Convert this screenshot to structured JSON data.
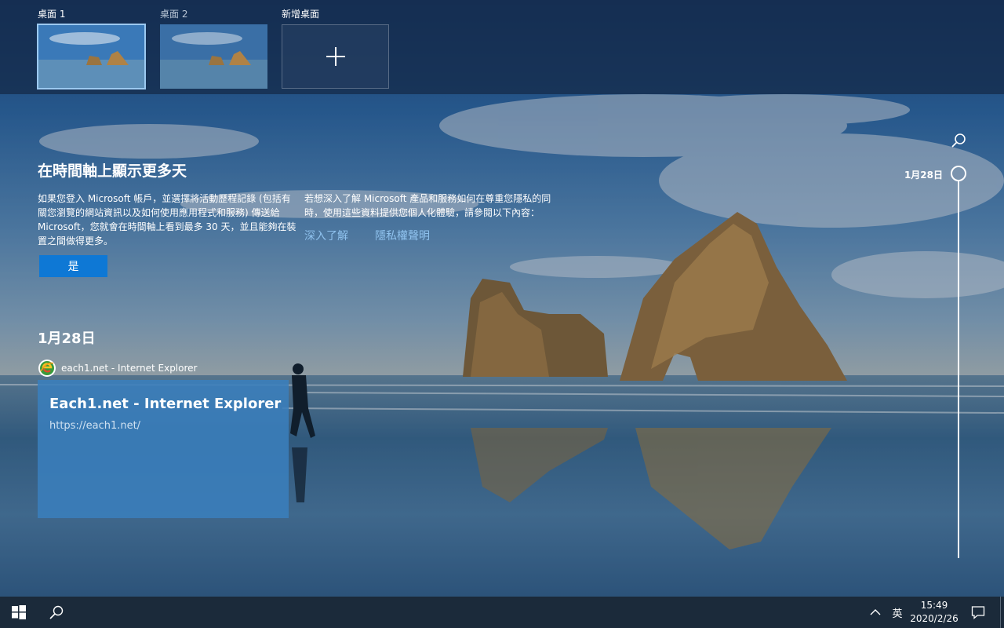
{
  "desktops": [
    {
      "label": "桌面 1",
      "active": true
    },
    {
      "label": "桌面 2",
      "active": false
    }
  ],
  "new_desktop_label": "新增桌面",
  "timeline": {
    "heading": "在時間軸上顯示更多天",
    "left_paragraph": "如果您登入 Microsoft 帳戶，並選擇將活動歷程記錄 (包括有關您瀏覽的網站資訊以及如何使用應用程式和服務) 傳送給 Microsoft，您就會在時間軸上看到最多 30 天，並且能夠在裝置之間做得更多。",
    "right_paragraph": "若想深入了解 Microsoft 產品和服務如何在尊重您隱私的同時，使用這些資料提供您個人化體驗，請參閱以下內容：",
    "learn_more_link": "深入了解",
    "privacy_link": "隱私權聲明",
    "yes_button": "是",
    "date_heading": "1月28日",
    "app_name": "each1.net - Internet Explorer",
    "card": {
      "title": "Each1.net - Internet Explorer",
      "url": "https://each1.net/"
    },
    "scrubber_label": "1月28日"
  },
  "taskbar": {
    "ime": "英",
    "time": "15:49",
    "date": "2020/2/26"
  },
  "icons": {
    "start": "windows-logo-icon",
    "search": "search-icon",
    "tray": "chevron-up-icon",
    "notifications": "action-center-icon",
    "app": "internet-explorer-icon"
  },
  "colors": {
    "accent": "#0e78d5",
    "link": "#8fc2ee",
    "taskbar": "#1b2a3a",
    "card": "#3a7ebc"
  }
}
